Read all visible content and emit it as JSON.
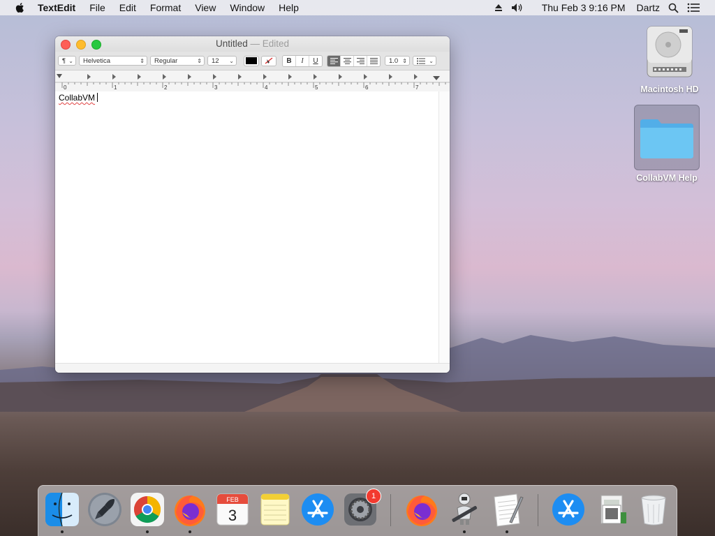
{
  "menubar": {
    "app_name": "TextEdit",
    "menus": [
      "File",
      "Edit",
      "Format",
      "View",
      "Window",
      "Help"
    ],
    "clock": "Thu Feb 3  9:16 PM",
    "user": "Dartz"
  },
  "desktop": {
    "icons": [
      {
        "label": "Macintosh HD",
        "icon": "hard-drive-icon"
      },
      {
        "label": "CollabVM Help",
        "icon": "folder-icon"
      }
    ]
  },
  "window": {
    "title": "Untitled",
    "title_suffix": "— Edited",
    "toolbar": {
      "paragraph_style": "¶",
      "font_family": "Helvetica",
      "font_style": "Regular",
      "font_size": "12",
      "bold": "B",
      "italic": "I",
      "underline": "U",
      "line_spacing": "1.0"
    },
    "ruler": {
      "marks": [
        "0",
        "1",
        "2",
        "3",
        "4",
        "5",
        "6",
        "7"
      ]
    },
    "document_text": "CollabVM"
  },
  "dock": {
    "calendar": {
      "month": "FEB",
      "day": "3"
    },
    "system_preferences_badge": "1"
  },
  "colors": {
    "accent": "#2a73d9",
    "close": "#fe5f57",
    "minimize": "#febc2e",
    "maximize": "#28c840",
    "badge": "#f23a2f"
  }
}
